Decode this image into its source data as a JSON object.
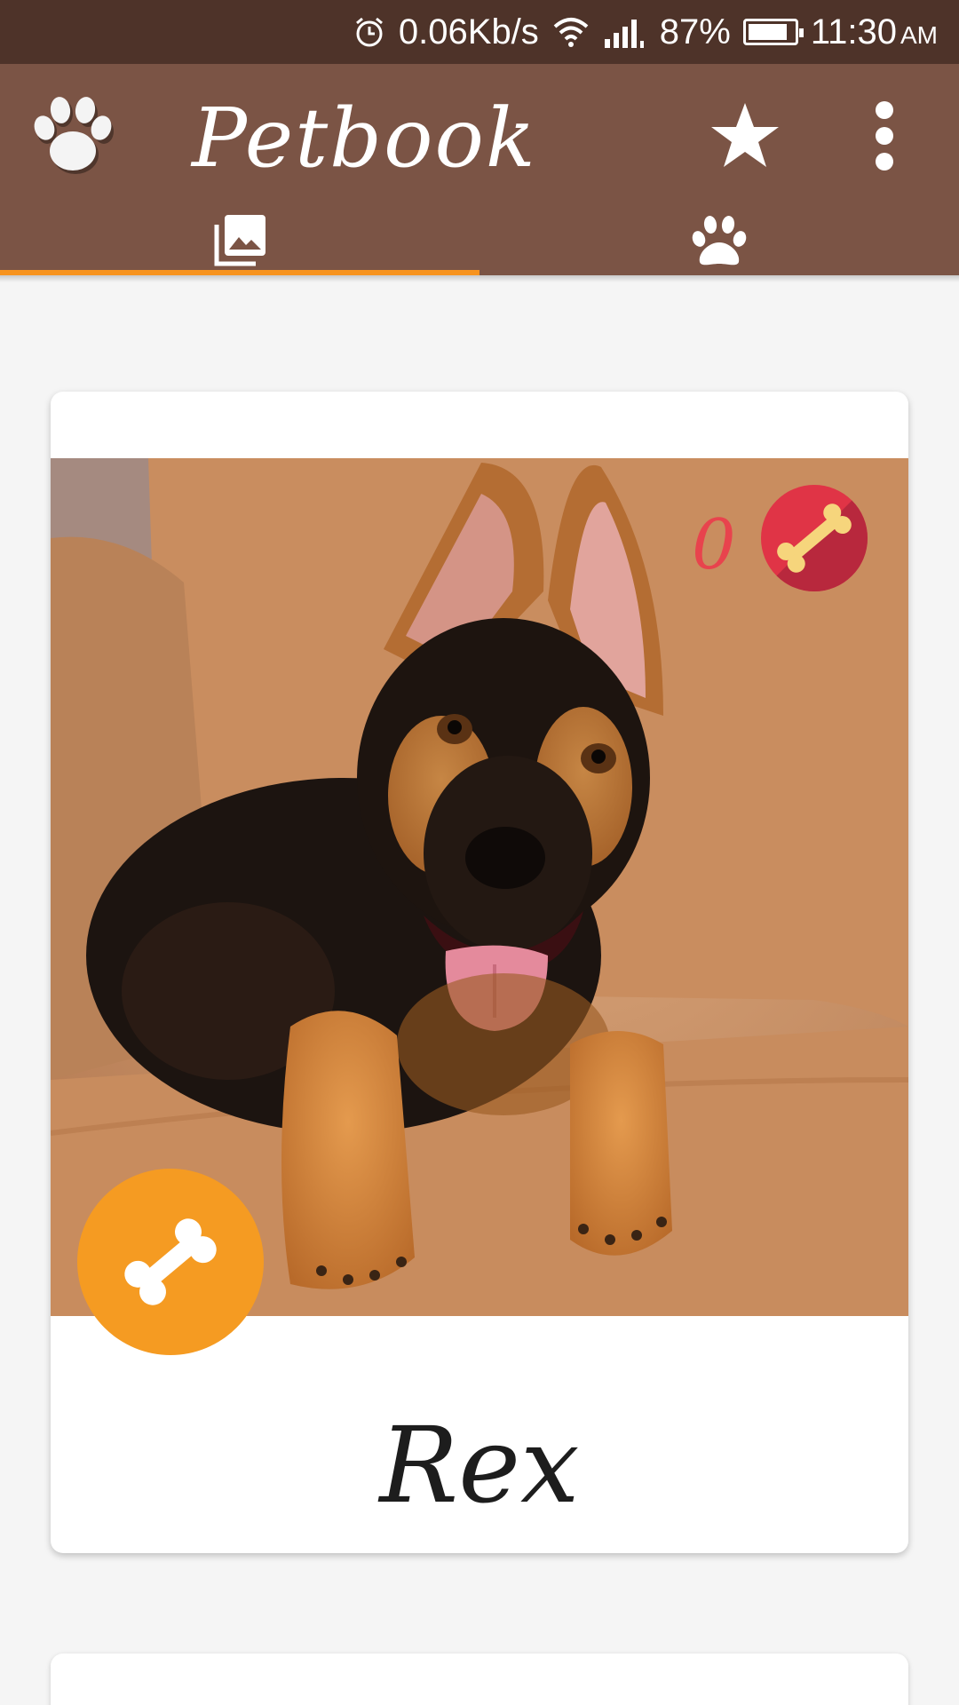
{
  "status_bar": {
    "network_speed": "0.06Kb/s",
    "battery_percent": "87%",
    "battery_level": 0.87,
    "time": "11:30",
    "ampm": "AM",
    "icons": [
      "alarm-icon",
      "wifi-icon",
      "signal-icon",
      "battery-icon"
    ]
  },
  "app_bar": {
    "title": "Petbook",
    "logo_icon": "paw-icon",
    "actions": [
      "star-icon",
      "overflow-menu-icon"
    ],
    "background": "#7b5445",
    "status_bar_background": "#4e3329"
  },
  "tabs": [
    {
      "icon": "photo-library-icon",
      "selected": true
    },
    {
      "icon": "paw-icon",
      "selected": false
    }
  ],
  "accent_color": "#f7931e",
  "feed": [
    {
      "name": "Rex",
      "like_count": "0",
      "photo_subject": "german-shepherd-puppy-on-sofa",
      "like_badge_color": "#e03446",
      "bone_button_color": "#f59b22"
    }
  ]
}
